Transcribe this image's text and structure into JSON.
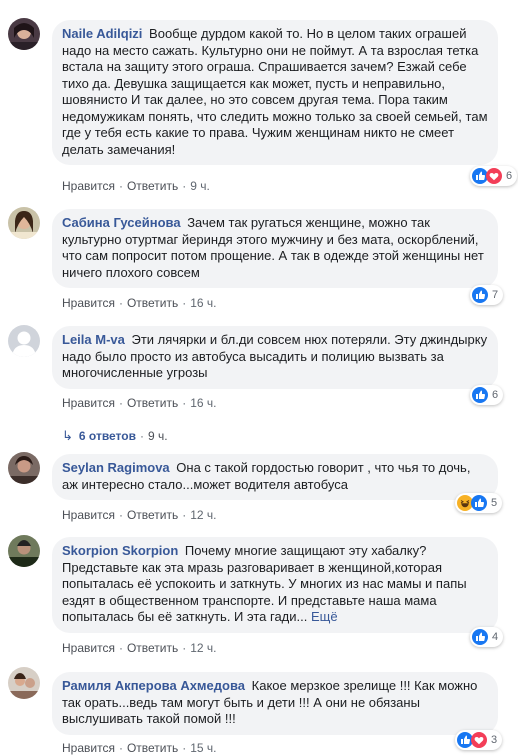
{
  "actions": {
    "like": "Нравится",
    "reply": "Ответить",
    "sep": "·"
  },
  "colors": {
    "link": "#385898",
    "bubble": "#f2f3f5",
    "like": "#1877f2",
    "love": "#f33e58",
    "haha": "#f7b125"
  },
  "comments": [
    {
      "author": "Naile Adilqizi",
      "text": "Вообще дурдом какой то. Но в целом таких ограшей надо на место сажать. Культурно они не поймут. А та взрослая тетка встала на защиту этого ограша. Спрашивается зачем? Езжай себе тихо да. Девушка защищается как может, пусть и неправильно, шовянисто И так далее, но это совсем другая тема. Пора таким недомужикам понять, что следить можно только за своей семьей, там где у тебя есть какие то права. Чужим женщинам никто не смеет делать замечания!",
      "time": "9 ч.",
      "reactions": [
        "like",
        "love"
      ],
      "count": "6"
    },
    {
      "author": "Сабина Гусейнова",
      "text": "Зачем так ругаться женщине, можно так культурно отуртмаг йериндя этого мужчину и без мата, оскорблений, что сам попросит потом прощение. А так в одежде этой женщины нет ничего плохого совсем",
      "time": "16 ч.",
      "reactions": [
        "like"
      ],
      "count": "7"
    },
    {
      "author": "Leila M-va",
      "text": "Эти лячярки и бл.ди совсем нюх потеряли. Эту джиндырку надо было просто из автобуса высадить и полицию вызвать за многочисленные угрозы",
      "time": "16 ч.",
      "reactions": [
        "like"
      ],
      "count": "6",
      "replies": {
        "label": "6 ответов",
        "time": "9 ч."
      }
    },
    {
      "author": "Seylan Ragimova",
      "text": "Она с такой гордостью говорит , что чья то дочь, аж интересно стало...может водителя автобуса",
      "time": "12 ч.",
      "reactions": [
        "haha",
        "like"
      ],
      "count": "5"
    },
    {
      "author": "Skorpion Skorpion",
      "text": "Почему многие защищают эту хабалку? Представьте как эта мразь разговаривает в женщиной,которая попыталась её успокоить и заткнуть. У многих из нас мамы и папы ездят в общественном транспорте. И представьте наша мама попыталась бы её заткнуть. И эта гади...",
      "more": "Ещё",
      "time": "12 ч.",
      "reactions": [
        "like"
      ],
      "count": "4"
    },
    {
      "author": "Рамиля Акперова Ахмедова",
      "text": "Какое мерзкое зрелище !!! Как можно так орать...ведь там могут быть и дети !!! А они не обязаны выслушивать такой помой !!!",
      "time": "15 ч.",
      "reactions": [
        "like",
        "love"
      ],
      "count": "3"
    }
  ]
}
